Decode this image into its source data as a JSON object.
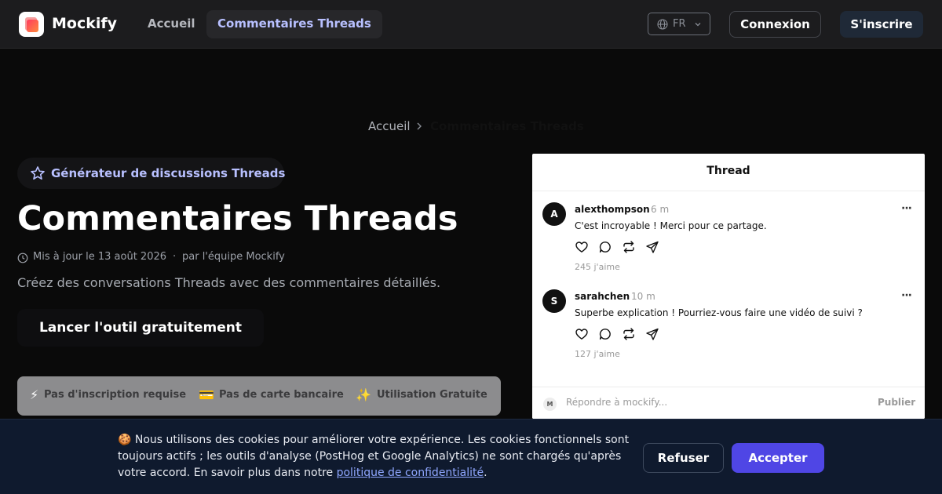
{
  "nav": {
    "brand": "Mockify",
    "links": [
      {
        "label": "Accueil",
        "active": false
      },
      {
        "label": "Commentaires Threads",
        "active": true
      }
    ],
    "language": "FR",
    "login_label": "Connexion",
    "signup_label": "S'inscrire"
  },
  "breadcrumb": {
    "home": "Accueil",
    "current": "Commentaires Threads"
  },
  "hero": {
    "badge": "Générateur de discussions Threads",
    "title": "Commentaires Threads",
    "updated": "Mis à jour le 13 août 2026",
    "separator": "·",
    "author": "par l'équipe Mockify",
    "description": "Créez des conversations Threads avec des commentaires détaillés.",
    "cta_label": "Lancer l'outil gratuitement",
    "features": [
      {
        "icon": "⚡",
        "label": "Pas d'inscription requise"
      },
      {
        "icon": "💳",
        "label": "Pas de carte bancaire"
      },
      {
        "icon": "✨",
        "label": "Utilisation Gratuite"
      }
    ]
  },
  "thread_card": {
    "title": "Thread",
    "posts": [
      {
        "avatar": "A",
        "username": "alexthompson",
        "time": "6 m",
        "more": "···",
        "text": "C'est incroyable ! Merci pour ce partage.",
        "likes": "245 j'aime"
      },
      {
        "avatar": "S",
        "username": "sarahchen",
        "time": "10 m",
        "more": "···",
        "text": "Superbe explication ! Pourriez-vous faire une vidéo de suivi ?",
        "likes": "127 j'aime"
      }
    ],
    "reply": {
      "avatar": "M",
      "placeholder": "Répondre à mockify...",
      "publish_label": "Publier"
    }
  },
  "cookie_banner": {
    "text_before": "🍪 Nous utilisons des cookies pour améliorer votre expérience. Les cookies fonctionnels sont toujours actifs ; les outils d'analyse (PostHog et Google Analytics) ne sont chargés qu'après votre accord. En savoir plus dans notre ",
    "link": "politique de confidentialité",
    "text_after": ".",
    "refuse_label": "Refuser",
    "accept_label": "Accepter"
  },
  "colors": {
    "accent": "#b8c0ff",
    "accept_button": "#4f46e5",
    "banner_bg": "#0f1a2e",
    "nav_bg": "#1c1c1e"
  }
}
